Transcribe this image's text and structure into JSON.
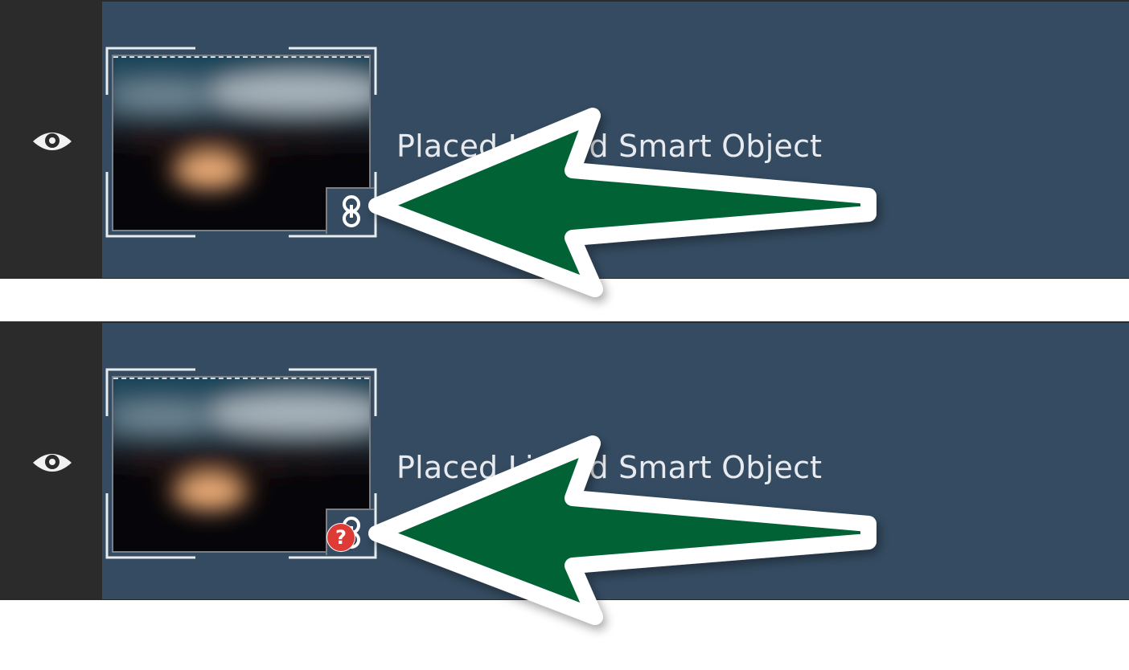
{
  "colors": {
    "panel_bg": "#344b61",
    "visibility_column": "#2b2b2b",
    "text": "#e7eaee",
    "annotation_arrow": "#036236",
    "arrow_outline": "#ffffff",
    "missing_badge": "#de3b36"
  },
  "layers": [
    {
      "name": "Placed Linked Smart Object",
      "visibility_icon": "eye-icon",
      "thumbnail": "blurred-night-photo",
      "badge_icon": "linked-chain-icon",
      "status": "linked"
    },
    {
      "name": "Placed Linked Smart Object",
      "visibility_icon": "eye-icon",
      "thumbnail": "blurred-night-photo",
      "badge_icon": "linked-chain-icon",
      "missing_badge_text": "?",
      "status": "missing"
    }
  ],
  "annotation": {
    "icon": "green-pointer-arrow"
  }
}
